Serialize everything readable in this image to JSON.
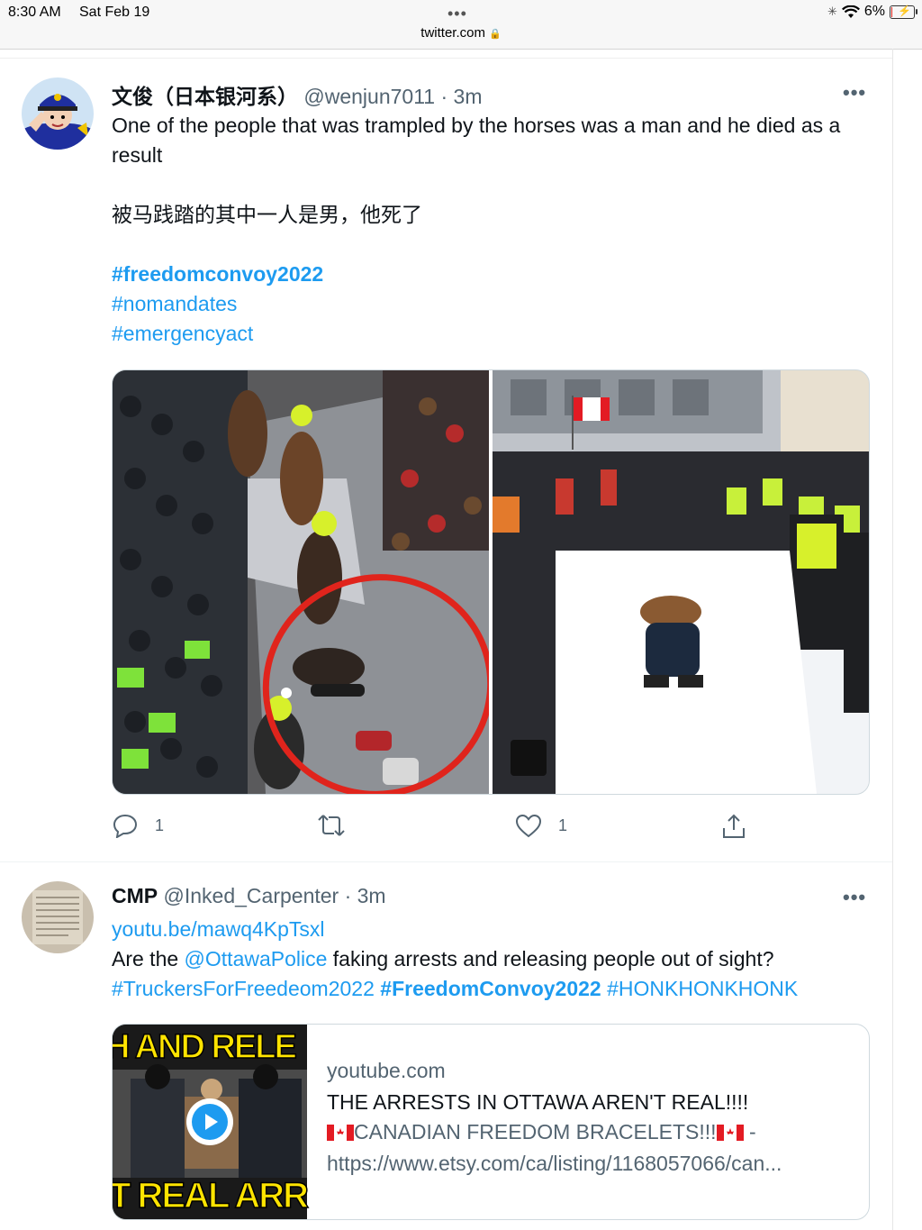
{
  "status_bar": {
    "time": "8:30 AM",
    "date": "Sat Feb 19",
    "dots": "•••",
    "url": "twitter.com",
    "battery": "6%",
    "battery_level": 0.06
  },
  "tweets": [
    {
      "display_name": "文俊（日本银河系）",
      "handle": "@wenjun7011",
      "time": "· 3m",
      "more": "•••",
      "text_en": "One of the people that was trampled by the horses was a man and he died as a result",
      "text_zh": "被马践踏的其中一人是男，他死了",
      "hashtags": [
        "#freedomconvoy2022",
        "#nomandates",
        "#emergencyact"
      ],
      "replies": "1",
      "likes": "1",
      "icons": [
        "reply-icon",
        "retweet-icon",
        "like-icon",
        "share-icon"
      ]
    },
    {
      "display_name": "CMP",
      "handle": "@Inked_Carpenter",
      "time": "· 3m",
      "more": "•••",
      "link": "youtu.be/mawq4KpTsxl",
      "text_before_mention": "Are the ",
      "mention": "@OttawaPolice",
      "text_after_mention": " faking arrests and releasing people out of sight?",
      "hashtags": [
        "#TruckersForFreedeom2022",
        "#FreedomConvoy2022",
        "#HONKHONKHONK"
      ],
      "card": {
        "domain": "youtube.com",
        "title": "THE ARRESTS IN OTTAWA AREN'T REAL!!!!",
        "desc_line1": "CANADIAN FREEDOM BRACELETS!!!",
        "desc_line1_suffix": " -",
        "desc_line2": "https://www.etsy.com/ca/listing/1168057066/can...",
        "thumb_top_text": "H AND RELE",
        "thumb_bottom_text": "T REAL ARR"
      }
    }
  ],
  "colors": {
    "link": "#1d9bf0",
    "text": "#0f1419",
    "muted": "#536471",
    "circle": "#e0241c"
  }
}
